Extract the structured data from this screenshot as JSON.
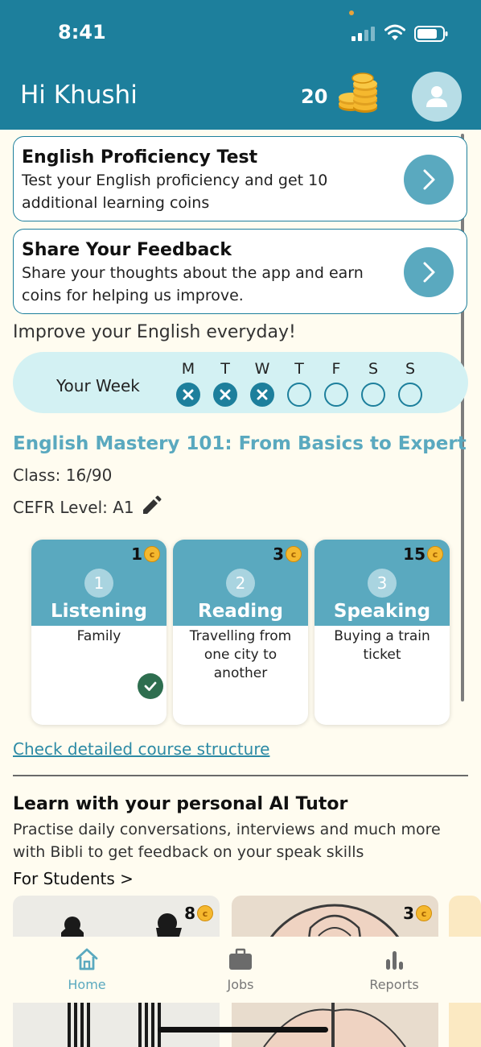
{
  "status_bar": {
    "time": "8:41"
  },
  "header": {
    "greeting": "Hi Khushi",
    "coins": "20"
  },
  "promos": [
    {
      "title": "English Proficiency Test",
      "desc": "Test your English proficiency and get 10 additional learning coins"
    },
    {
      "title": "Share Your Feedback",
      "desc": "Share your thoughts about the app and earn coins for helping us improve."
    }
  ],
  "subhead": "Improve your English everyday!",
  "week": {
    "label": "Your Week",
    "days": [
      {
        "letter": "M",
        "done": true
      },
      {
        "letter": "T",
        "done": true
      },
      {
        "letter": "W",
        "done": true
      },
      {
        "letter": "T",
        "done": false
      },
      {
        "letter": "F",
        "done": false
      },
      {
        "letter": "S",
        "done": false
      },
      {
        "letter": "S",
        "done": false
      }
    ]
  },
  "course": {
    "title": "English Mastery 101: From Basics to Expert",
    "class": "Class: 16/90",
    "cefr": "CEFR Level: A1",
    "link": "Check detailed course structure",
    "lessons": [
      {
        "num": "1",
        "coins": "1",
        "name": "Listening",
        "topic": "Family",
        "completed": true
      },
      {
        "num": "2",
        "coins": "3",
        "name": "Reading",
        "topic": "Travelling from one city to another",
        "completed": false
      },
      {
        "num": "3",
        "coins": "15",
        "name": "Speaking",
        "topic": "Buying a train ticket",
        "completed": false
      }
    ]
  },
  "tutor": {
    "title": "Learn with your personal AI Tutor",
    "desc": "Practise daily conversations, interviews and much more with Bibli to get feedback on your speak skills",
    "students_link": "For Students >",
    "cards": [
      {
        "coins": "8"
      },
      {
        "coins": "3"
      }
    ]
  },
  "nav": {
    "items": [
      {
        "label": "Home",
        "icon": "home-icon",
        "active": true
      },
      {
        "label": "Jobs",
        "icon": "briefcase-icon",
        "active": false
      },
      {
        "label": "Reports",
        "icon": "bar-chart-icon",
        "active": false
      }
    ]
  },
  "colors": {
    "primary": "#1d7f9c",
    "accent": "#5aa9bf",
    "week_bg": "#d3f1f3",
    "background": "#fffcf0",
    "coin": "#f5b82e"
  }
}
